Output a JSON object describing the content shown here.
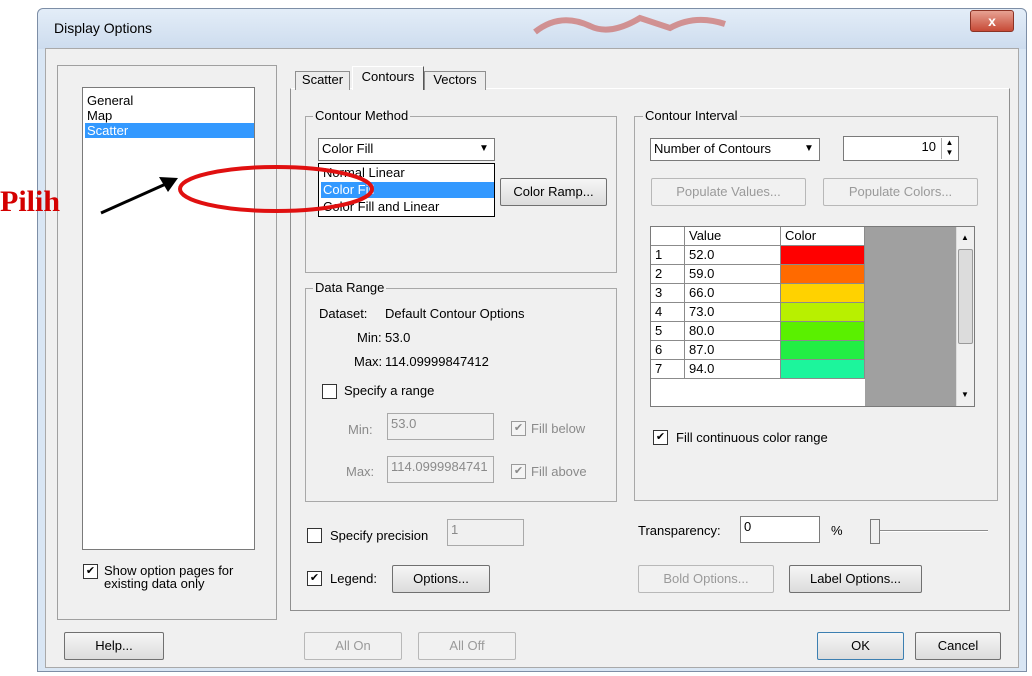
{
  "window": {
    "title": "Display Options",
    "close_glyph": "x"
  },
  "left_list": {
    "items": [
      {
        "label": "General"
      },
      {
        "label": "Map"
      },
      {
        "label": "Scatter",
        "selected": true
      }
    ]
  },
  "show_pages": {
    "checked": true,
    "label_line1": "Show option pages for",
    "label_line2": "existing data only"
  },
  "tabs": [
    {
      "label": "Scatter"
    },
    {
      "label": "Contours",
      "active": true
    },
    {
      "label": "Vectors"
    }
  ],
  "contour_method": {
    "group_label": "Contour Method",
    "combo_value": "Color Fill",
    "options": [
      "Normal Linear",
      "Color Fill",
      "Color Fill and Linear"
    ],
    "selected_option": "Color Fill",
    "color_ramp_button": "Color Ramp..."
  },
  "data_range": {
    "group_label": "Data Range",
    "dataset_label": "Dataset:",
    "dataset_value": "Default Contour Options",
    "min_label": "Min:",
    "min_value": "53.0",
    "max_label": "Max:",
    "max_value": "114.09999847412",
    "specify_range": {
      "checked": false,
      "label": "Specify a range"
    },
    "min_field_label": "Min:",
    "min_field_value": "53.0",
    "max_field_label": "Max:",
    "max_field_value": "114.0999984741",
    "fill_below": {
      "checked": true,
      "label": "Fill below"
    },
    "fill_above": {
      "checked": true,
      "label": "Fill above"
    }
  },
  "contour_interval": {
    "group_label": "Contour Interval",
    "combo_value": "Number of Contours",
    "count": "10",
    "populate_values_button": "Populate Values...",
    "populate_colors_button": "Populate Colors...",
    "table_headers": [
      "Value",
      "Color"
    ],
    "rows": [
      {
        "index": "1",
        "value": "52.0",
        "color": "#ff0000"
      },
      {
        "index": "2",
        "value": "59.0",
        "color": "#ff6a00"
      },
      {
        "index": "3",
        "value": "66.0",
        "color": "#ffd200"
      },
      {
        "index": "4",
        "value": "73.0",
        "color": "#b8f000"
      },
      {
        "index": "5",
        "value": "80.0",
        "color": "#5af000"
      },
      {
        "index": "6",
        "value": "87.0",
        "color": "#22ee44"
      },
      {
        "index": "7",
        "value": "94.0",
        "color": "#1cf59c"
      }
    ],
    "fill_continuous": {
      "checked": true,
      "label": "Fill continuous color range"
    }
  },
  "precision": {
    "checked": false,
    "label": "Specify precision",
    "value": "1"
  },
  "legend": {
    "checked": true,
    "label": "Legend:",
    "options_button": "Options..."
  },
  "transparency": {
    "label": "Transparency:",
    "value": "0",
    "unit": "%",
    "slider_level": 0
  },
  "bold_options_button": "Bold Options...",
  "label_options_button": "Label Options...",
  "bottom": {
    "help": "Help...",
    "all_on": "All On",
    "all_off": "All Off",
    "ok": "OK",
    "cancel": "Cancel"
  },
  "annotation": {
    "label": "Pilih",
    "color": "#d40000"
  }
}
